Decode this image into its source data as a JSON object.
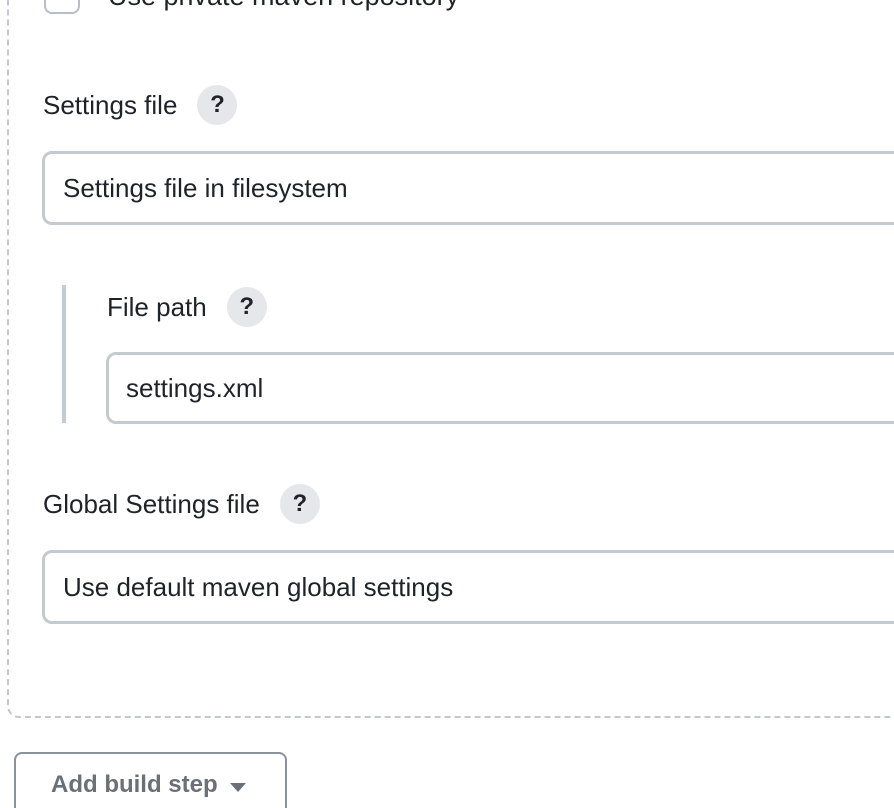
{
  "private_repo": {
    "label": "Use private maven repository",
    "checked": false
  },
  "settings_file": {
    "label": "Settings file",
    "help": "?",
    "selected": "Settings file in filesystem"
  },
  "file_path": {
    "label": "File path",
    "help": "?",
    "value": "settings.xml"
  },
  "global_settings_file": {
    "label": "Global Settings file",
    "help": "?",
    "selected": "Use default maven global settings"
  },
  "add_build_step": {
    "label": "Add build step",
    "icon": "caret-down-icon"
  }
}
